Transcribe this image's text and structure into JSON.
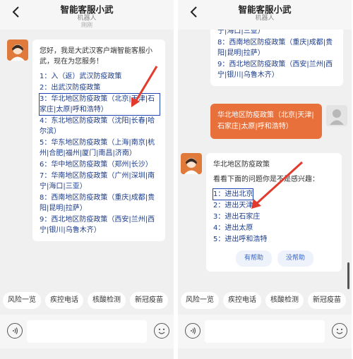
{
  "header": {
    "title": "智能客服小武",
    "subtitle": "机器人",
    "status": "刚刚"
  },
  "left": {
    "greeting": "您好，我是大武汉客户端智能客服小武，现在为您服务！",
    "menu": [
      "1：入（返）武汉防疫政策",
      "2：出武汉防疫政策",
      "3：华北地区防疫政策（北京|天津|石家庄|太原|呼和浩特）",
      "4：东北地区防疫政策（沈阳|长春|哈尔滨）",
      "5：华东地区防疫政策（上海|南京|杭州|合肥|福州|厦门|南昌|济南）",
      "6：华中地区防疫政策（郑州|长沙）",
      "7：华南地区防疫政策（广州|深圳|南宁|海口|三亚）",
      "8：西南地区防疫政策（重庆|成都|贵阳|昆明|拉萨）",
      "9：西北地区防疫政策（西安|兰州|西宁|银川|乌鲁木齐）"
    ]
  },
  "right": {
    "top_menu": [
      "7：华南地区防疫政策（广州|深圳|南宁|海口|三亚）",
      "8：西南地区防疫政策（重庆|成都|贵阳|昆明|拉萨）",
      "9：西北地区防疫政策（西安|兰州|西宁|银川|乌鲁木齐）"
    ],
    "user_message": "华北地区防疫政策（北京|天津|石家庄|太原|呼和浩特）",
    "reply_title": "华北地区防疫政策",
    "reply_prompt": "看看下面的问题你是不是感兴趣：",
    "reply_items": [
      "1：进出北京",
      "2：进出天津",
      "3：进出石家庄",
      "4：进出太原",
      "5：进出呼和浩特"
    ],
    "helpful": "有帮助",
    "not_helpful": "没帮助"
  },
  "quick_replies": [
    "风险一览",
    "疾控电话",
    "核酸检测",
    "新冠疫苗"
  ],
  "colors": {
    "accent": "#e8703a",
    "link": "#1a3b8c",
    "arrow": "#e23b2e",
    "highlight_box": "#1f46b4"
  }
}
